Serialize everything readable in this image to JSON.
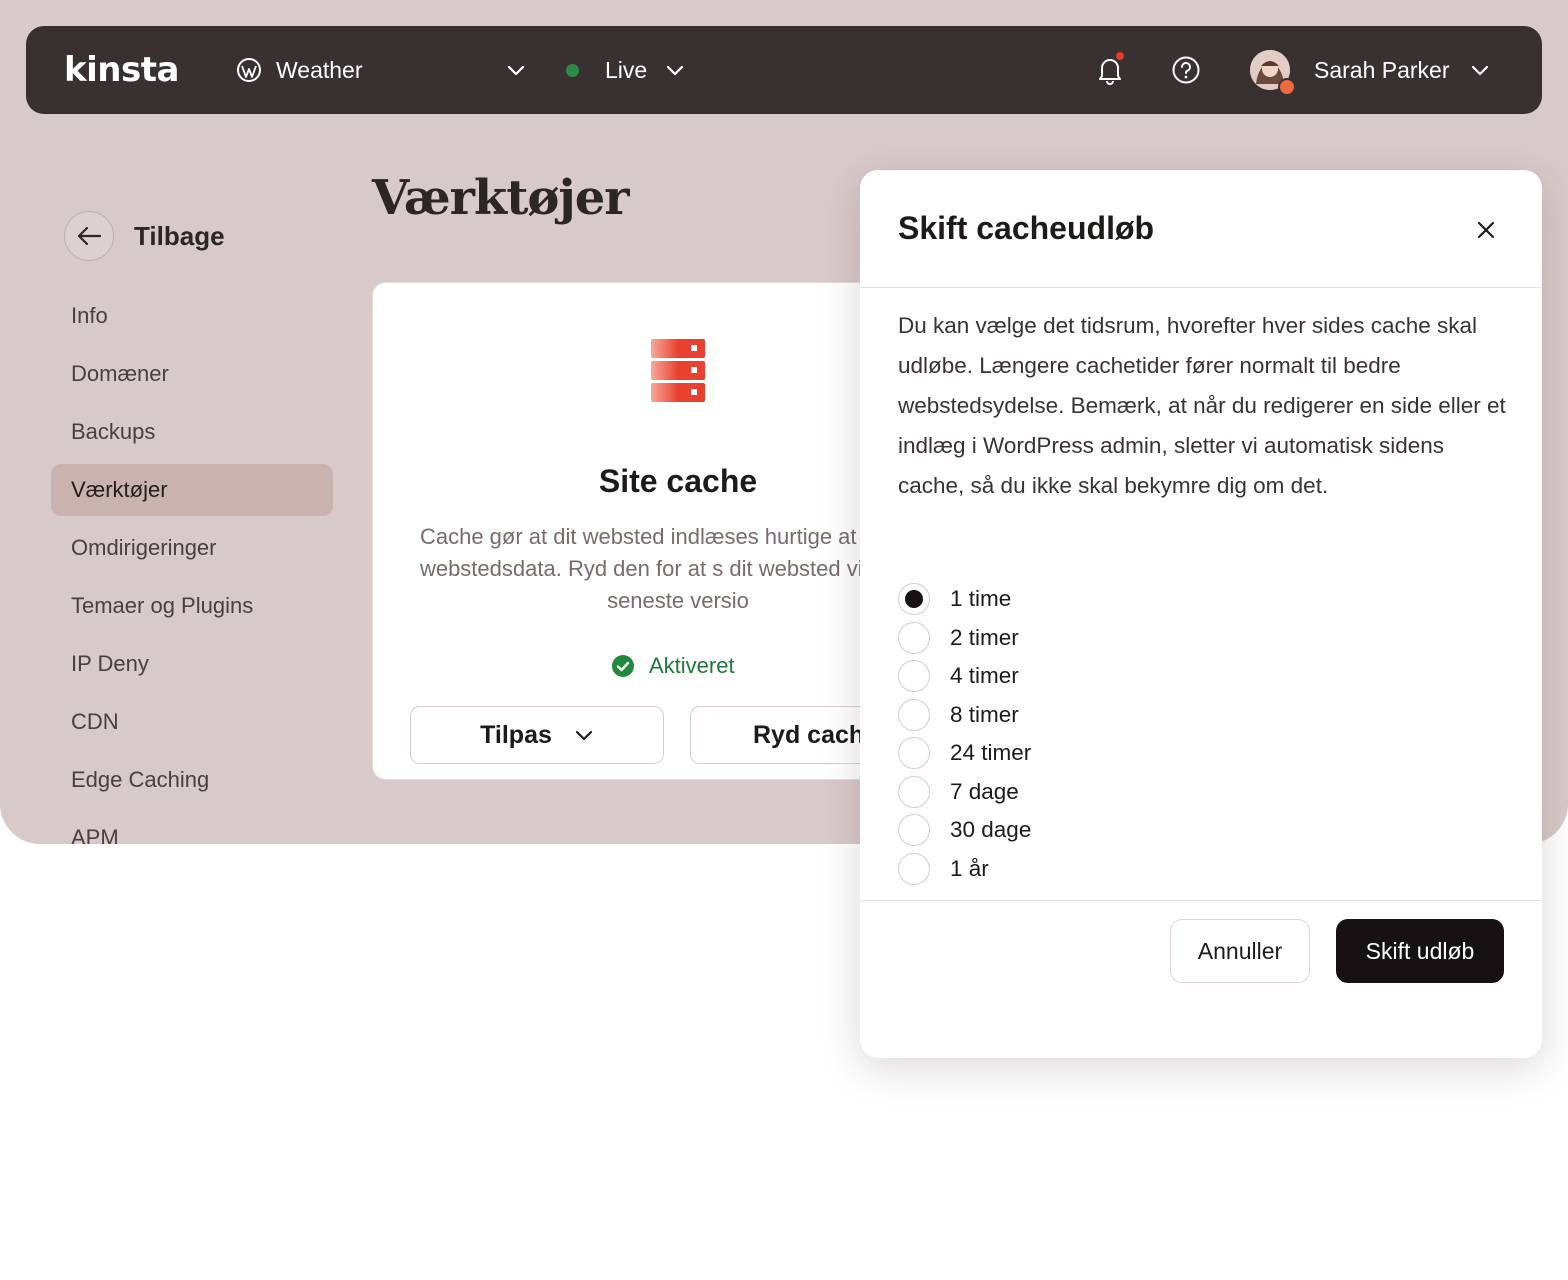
{
  "topbar": {
    "logo": "kinsta",
    "site_name": "Weather",
    "environment": "Live",
    "environment_color": "#2e8a4a",
    "user_name": "Sarah Parker",
    "icons": [
      "wordpress-icon",
      "chevron-down-icon",
      "bell-icon",
      "help-icon"
    ]
  },
  "sidebar": {
    "back_label": "Tilbage",
    "items": [
      {
        "label": "Info"
      },
      {
        "label": "Domæner"
      },
      {
        "label": "Backups"
      },
      {
        "label": "Værktøjer",
        "active": true
      },
      {
        "label": "Omdirigeringer"
      },
      {
        "label": "Temaer og Plugins"
      },
      {
        "label": "IP Deny"
      },
      {
        "label": "CDN"
      },
      {
        "label": "Edge Caching"
      },
      {
        "label": "APM"
      }
    ]
  },
  "main": {
    "page_title": "Værktøjer",
    "card": {
      "title": "Site cache",
      "description": "Cache gør at dit websted indlæses hurtige at gemme webstedsdata. Ryd den for at s dit websted viser den seneste versio",
      "status": "Aktiveret",
      "customize_label": "Tilpas",
      "clear_label": "Ryd cach",
      "accent_color": "#e8412f"
    }
  },
  "modal": {
    "title": "Skift cacheudløb",
    "description": "Du kan vælge det tidsrum, hvorefter hver sides cache skal udløbe. Længere cachetider fører normalt til bedre webstedsydelse. Bemærk, at når du redigerer en side eller et indlæg i WordPress admin, sletter vi automatisk sidens cache, så du ikke skal bekymre dig om det.",
    "options": [
      {
        "label": "1 time",
        "checked": true
      },
      {
        "label": "2 timer"
      },
      {
        "label": "4 timer"
      },
      {
        "label": "8 timer"
      },
      {
        "label": "24 timer"
      },
      {
        "label": "7 dage"
      },
      {
        "label": "30 dage"
      },
      {
        "label": "1 år"
      }
    ],
    "cancel_label": "Annuller",
    "confirm_label": "Skift udløb"
  }
}
